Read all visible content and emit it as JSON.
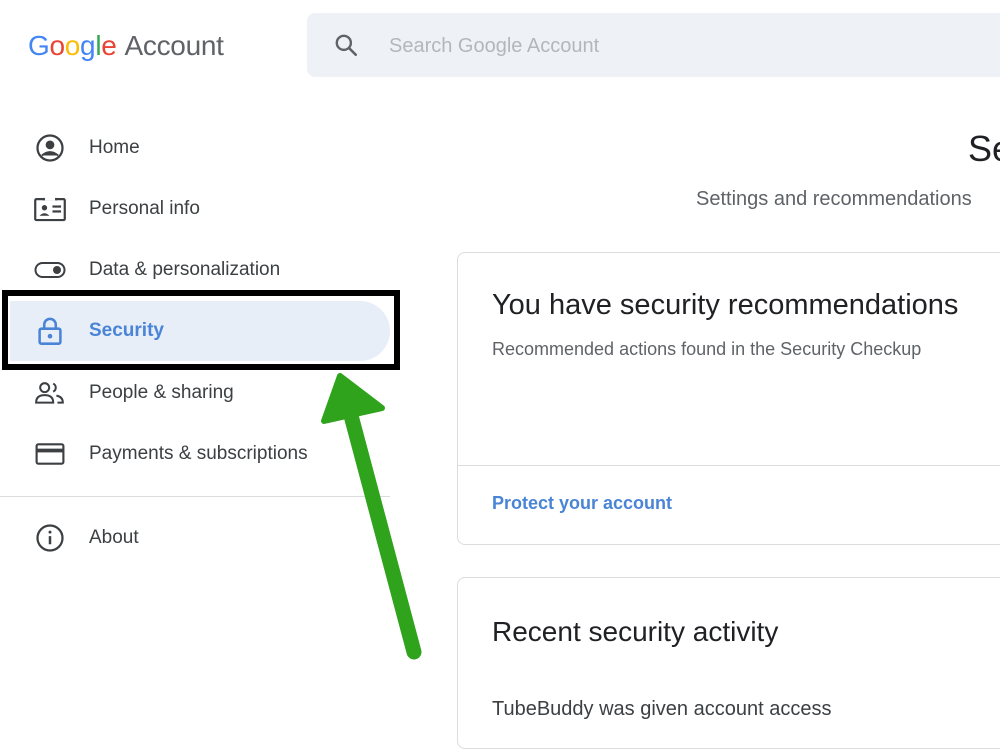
{
  "header": {
    "logo_letters": [
      "G",
      "o",
      "o",
      "g",
      "l",
      "e"
    ],
    "logo_suffix": "Account",
    "search_placeholder": "Search Google Account"
  },
  "sidebar": {
    "items": [
      {
        "label": "Home",
        "icon": "account-circle-icon"
      },
      {
        "label": "Personal info",
        "icon": "id-card-icon"
      },
      {
        "label": "Data & personalization",
        "icon": "toggle-icon"
      },
      {
        "label": "Security",
        "icon": "lock-icon",
        "active": true
      },
      {
        "label": "People & sharing",
        "icon": "people-icon"
      },
      {
        "label": "Payments & subscriptions",
        "icon": "credit-card-icon"
      },
      {
        "label": "About",
        "icon": "info-icon"
      }
    ]
  },
  "main": {
    "title": "Se",
    "subtitle": "Settings and recommendations",
    "recommendations_card": {
      "title": "You have security recommendations",
      "description": "Recommended actions found in the Security Checkup",
      "link": "Protect your account"
    },
    "activity_card": {
      "title": "Recent security activity",
      "item": "TubeBuddy was given account access"
    }
  },
  "colors": {
    "accent": "#4a84d6",
    "active_bg": "#e8eef8",
    "annotation_arrow": "#2fa31c",
    "annotation_box": "#000000"
  }
}
